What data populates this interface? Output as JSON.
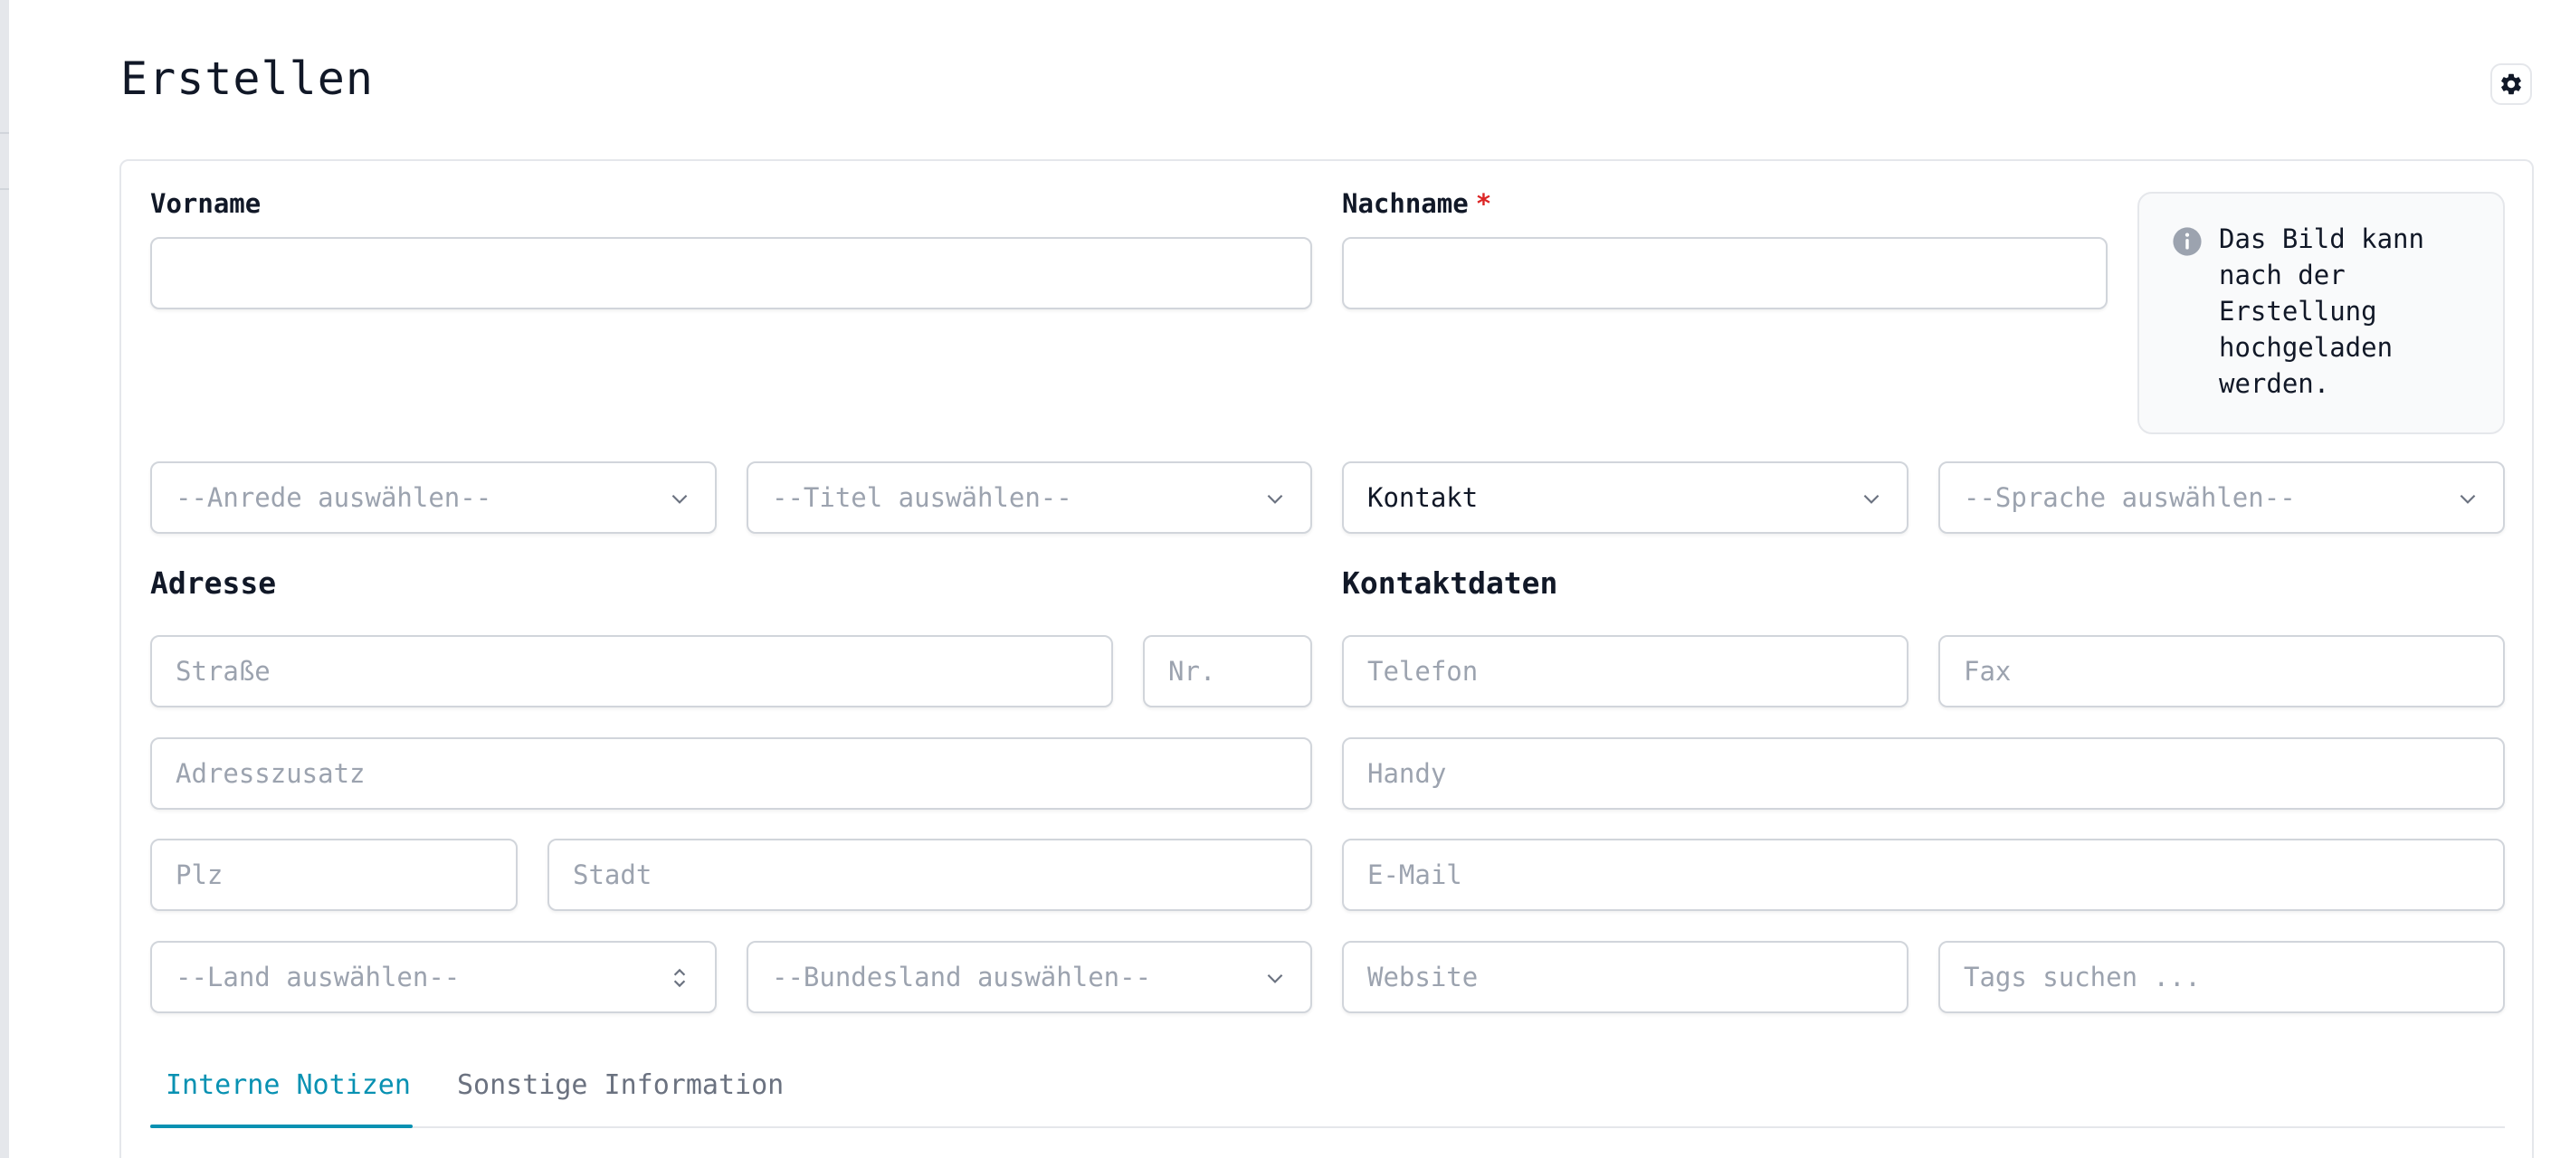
{
  "page": {
    "title": "Erstellen",
    "settings_icon": "gear-icon"
  },
  "name": {
    "vorname_label": "Vorname",
    "vorname_value": "",
    "nachname_label": "Nachname",
    "nachname_required": "*",
    "nachname_value": ""
  },
  "info": {
    "icon": "info-icon",
    "text": "Das Bild kann nach der Erstellung hochgeladen werden."
  },
  "selects": {
    "anrede": "--Anrede auswählen--",
    "titel": "--Titel auswählen--",
    "kontakt": "Kontakt",
    "sprache": "--Sprache auswählen--",
    "land": "--Land auswählen--",
    "bundesland": "--Bundesland auswählen--"
  },
  "address": {
    "title": "Adresse",
    "strasse_placeholder": "Straße",
    "nr_placeholder": "Nr.",
    "zusatz_placeholder": "Adresszusatz",
    "plz_placeholder": "Plz",
    "stadt_placeholder": "Stadt"
  },
  "contact": {
    "title": "Kontaktdaten",
    "telefon_placeholder": "Telefon",
    "fax_placeholder": "Fax",
    "handy_placeholder": "Handy",
    "email_placeholder": "E-Mail",
    "website_placeholder": "Website",
    "tags_placeholder": "Tags suchen ..."
  },
  "tabs": [
    {
      "label": "Interne Notizen",
      "active": true
    },
    {
      "label": "Sonstige Information",
      "active": false
    }
  ],
  "colors": {
    "accent": "#0891b2",
    "required": "#dc2626",
    "border": "#d1d5db",
    "placeholder": "#9ca3af"
  }
}
